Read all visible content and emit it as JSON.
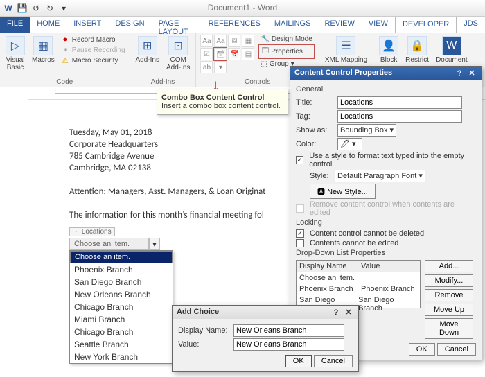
{
  "window": {
    "title": "Document1 - Word"
  },
  "tabs": [
    "FILE",
    "HOME",
    "INSERT",
    "DESIGN",
    "PAGE LAYOUT",
    "REFERENCES",
    "MAILINGS",
    "REVIEW",
    "VIEW",
    "DEVELOPER",
    "JDS"
  ],
  "active_tab_index": 9,
  "ribbon": {
    "code": {
      "label": "Code",
      "visual_basic": "Visual\nBasic",
      "macros": "Macros",
      "record": "Record Macro",
      "pause": "Pause Recording",
      "security": "Macro Security"
    },
    "addins": {
      "label": "Add-Ins",
      "addins": "Add-Ins",
      "com": "COM\nAdd-Ins"
    },
    "controls": {
      "label": "Controls",
      "design": "Design Mode",
      "properties": "Properties",
      "group": "Group"
    },
    "mapping": {
      "label": "",
      "xml": "XML Mapping"
    },
    "protect": {
      "block": "Block",
      "restrict": "Restrict"
    },
    "templates": {
      "doc": "Document"
    }
  },
  "tooltip": {
    "title": "Combo Box Content Control",
    "body": "Insert a combo box content control."
  },
  "document": {
    "date": "Tuesday, May 01, 2018",
    "l1": "Corporate Headquarters",
    "l2": "785 Cambridge Avenue",
    "l3": "Cambridge, MA 02138",
    "attn": "Attention: Managers, Asst. Managers, & Loan Originat",
    "info": "The information for this month’s financial meeting fol",
    "combo_tag": "Locations",
    "combo_selected": "Choose an item.",
    "options": [
      "Choose an item.",
      "Phoenix Branch",
      "San Diego Branch",
      "New Orleans Branch",
      "Chicago Branch",
      "Miami Branch",
      "Chicago Branch",
      "Seattle Branch",
      "New York Branch"
    ]
  },
  "ccp": {
    "title": "Content Control Properties",
    "general": "General",
    "title_lbl": "Title:",
    "title_val": "Locations",
    "tag_lbl": "Tag:",
    "tag_val": "Locations",
    "show_lbl": "Show as:",
    "show_val": "Bounding Box",
    "color_lbl": "Color:",
    "use_style": "Use a style to format text typed into the empty control",
    "style_lbl": "Style:",
    "style_val": "Default Paragraph Font",
    "new_style": "New Style...",
    "remove": "Remove content control when contents are edited",
    "locking": "Locking",
    "lock_del": "Content control cannot be deleted",
    "lock_edit": "Contents cannot be edited",
    "ddlp": "Drop-Down List Properties",
    "col_name": "Display Name",
    "col_val": "Value",
    "rows": [
      {
        "name": "Choose an item.",
        "val": ""
      },
      {
        "name": "Phoenix Branch",
        "val": "Phoenix Branch"
      },
      {
        "name": "San Diego Branch",
        "val": "San Diego Branch"
      }
    ],
    "btns": {
      "add": "Add...",
      "modify": "Modify...",
      "remove": "Remove",
      "up": "Move Up",
      "down": "Move Down"
    },
    "ok": "OK",
    "cancel": "Cancel"
  },
  "add_choice": {
    "title": "Add Choice",
    "name_lbl": "Display Name:",
    "name_val": "New Orleans Branch",
    "val_lbl": "Value:",
    "val_val": "New Orleans Branch",
    "ok": "OK",
    "cancel": "Cancel"
  }
}
